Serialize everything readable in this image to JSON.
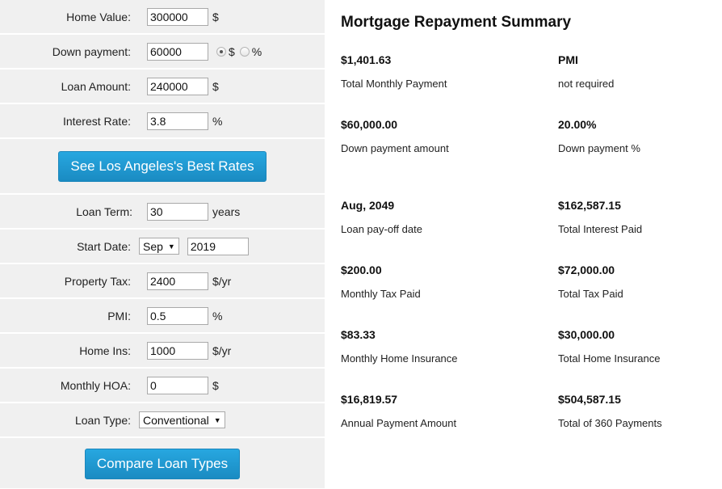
{
  "form": {
    "home_value": {
      "label": "Home Value:",
      "value": "300000",
      "unit": "$"
    },
    "down_payment": {
      "label": "Down payment:",
      "value": "60000",
      "radio_dollar": "$",
      "radio_percent": "%",
      "selected": "$"
    },
    "loan_amount": {
      "label": "Loan Amount:",
      "value": "240000",
      "unit": "$"
    },
    "interest_rate": {
      "label": "Interest Rate:",
      "value": "3.8",
      "unit": "%"
    },
    "best_rates_button": "See Los Angeles's Best Rates",
    "loan_term": {
      "label": "Loan Term:",
      "value": "30",
      "unit": "years"
    },
    "start_date": {
      "label": "Start Date:",
      "month": "Sep",
      "year": "2019"
    },
    "property_tax": {
      "label": "Property Tax:",
      "value": "2400",
      "unit": "$/yr"
    },
    "pmi": {
      "label": "PMI:",
      "value": "0.5",
      "unit": "%"
    },
    "home_ins": {
      "label": "Home Ins:",
      "value": "1000",
      "unit": "$/yr"
    },
    "monthly_hoa": {
      "label": "Monthly HOA:",
      "value": "0",
      "unit": "$"
    },
    "loan_type": {
      "label": "Loan Type:",
      "value": "Conventional"
    },
    "compare_button": "Compare Loan Types"
  },
  "summary": {
    "title": "Mortgage Repayment Summary",
    "items": [
      {
        "value": "$1,401.63",
        "label": "Total Monthly Payment"
      },
      {
        "value": "PMI",
        "label": "not required"
      },
      {
        "value": "$60,000.00",
        "label": "Down payment amount"
      },
      {
        "value": "20.00%",
        "label": "Down payment %"
      },
      {
        "value": "Aug, 2049",
        "label": "Loan pay-off date"
      },
      {
        "value": "$162,587.15",
        "label": "Total Interest Paid"
      },
      {
        "value": "$200.00",
        "label": "Monthly Tax Paid"
      },
      {
        "value": "$72,000.00",
        "label": "Total Tax Paid"
      },
      {
        "value": "$83.33",
        "label": "Monthly Home Insurance"
      },
      {
        "value": "$30,000.00",
        "label": "Total Home Insurance"
      },
      {
        "value": "$16,819.57",
        "label": "Annual Payment Amount"
      },
      {
        "value": "$504,587.15",
        "label": "Total of 360 Payments"
      }
    ]
  },
  "colors": {
    "button": "#1e9ad3",
    "panel": "#f0f0f0"
  }
}
